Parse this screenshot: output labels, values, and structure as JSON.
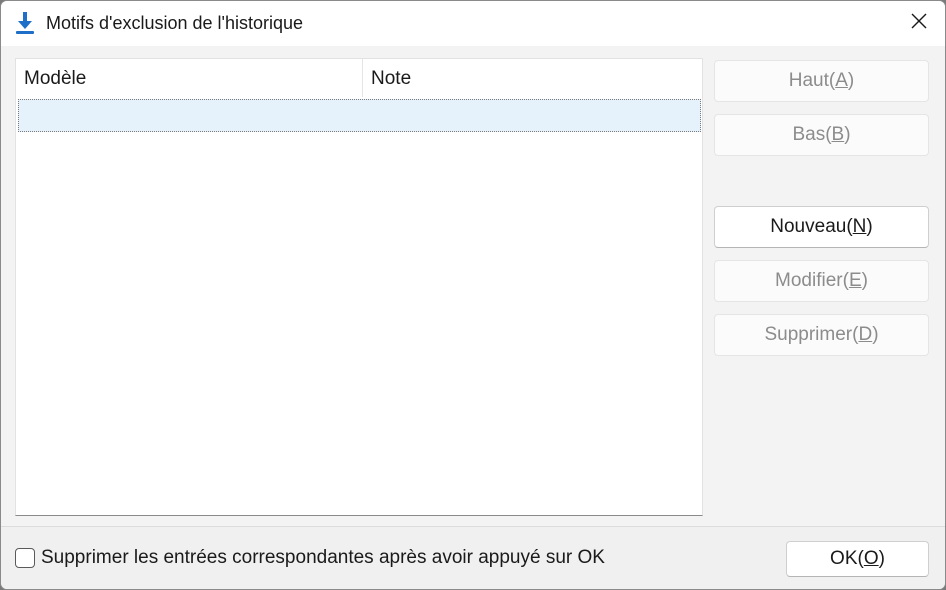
{
  "window": {
    "title": "Motifs d'exclusion de l'historique",
    "icon": "download-arrow-icon"
  },
  "list": {
    "columns": [
      "Modèle",
      "Note"
    ],
    "rows": [
      {
        "model": "",
        "note": ""
      }
    ]
  },
  "buttons": {
    "up": {
      "label": "Haut(",
      "mnemonic": "A",
      "suffix": ")",
      "enabled": false
    },
    "down": {
      "label": "Bas(",
      "mnemonic": "B",
      "suffix": ")",
      "enabled": false
    },
    "new": {
      "label": "Nouveau(",
      "mnemonic": "N",
      "suffix": ")",
      "enabled": true
    },
    "edit": {
      "label": "Modifier(",
      "mnemonic": "E",
      "suffix": ")",
      "enabled": false
    },
    "delete": {
      "label": "Supprimer(",
      "mnemonic": "D",
      "suffix": ")",
      "enabled": false
    }
  },
  "footer": {
    "checkbox_label": "Supprimer les entrées correspondantes après avoir appuyé sur OK",
    "checkbox_checked": false,
    "ok": {
      "label": "OK(",
      "mnemonic": "O",
      "suffix": ")"
    }
  },
  "colors": {
    "icon_blue": "#1e6fc7",
    "selection": "#e5f1fb",
    "disabled_text": "#8c8c8c"
  }
}
